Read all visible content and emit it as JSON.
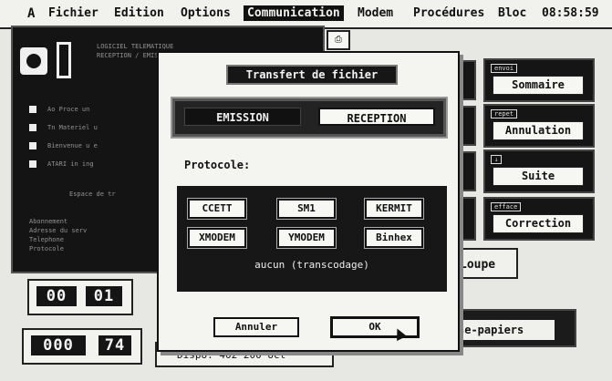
{
  "menubar": {
    "logo": "A",
    "items": [
      "Fichier",
      "Edition",
      "Options",
      "Communication",
      "Modem",
      "Procédures",
      "Bloc"
    ],
    "clock": "08:58:59"
  },
  "background": {
    "text_lines": [
      "LOGICIEL TELEMATIQUE",
      "RECEPTION / EMISSION",
      "Ao Proce un",
      "Tn Materiel u",
      "Bienvenue u e",
      "ATARI in ing",
      "Espace de tr",
      "Abonnement",
      "Adresse du serv",
      "Telephone",
      "Protocole"
    ],
    "small_icon": "⎙"
  },
  "right_buttons": {
    "sommaire": {
      "tag": "envoi",
      "label": "Sommaire"
    },
    "annulation": {
      "tag": "repet",
      "label": "Annulation"
    },
    "suite": {
      "tag": "↓",
      "label": "Suite"
    },
    "correction": {
      "tag": "efface",
      "label": "Correction"
    },
    "loupe": "Loupe",
    "papiers": "se-papiers"
  },
  "counters": {
    "top": [
      "00",
      "01"
    ],
    "bottom": [
      "000",
      "74"
    ],
    "dispo": "Dispo.  402 200 oct"
  },
  "dialog": {
    "title": "Transfert de fichier",
    "emission": "EMISSION",
    "reception": "RECEPTION",
    "protocole_label": "Protocole:",
    "protocols": [
      "CCETT",
      "SM1",
      "KERMIT",
      "XMODEM",
      "YMODEM",
      "Binhex"
    ],
    "transcodage": "aucun (transcodage)",
    "annuler": "Annuler",
    "ok": "OK"
  }
}
